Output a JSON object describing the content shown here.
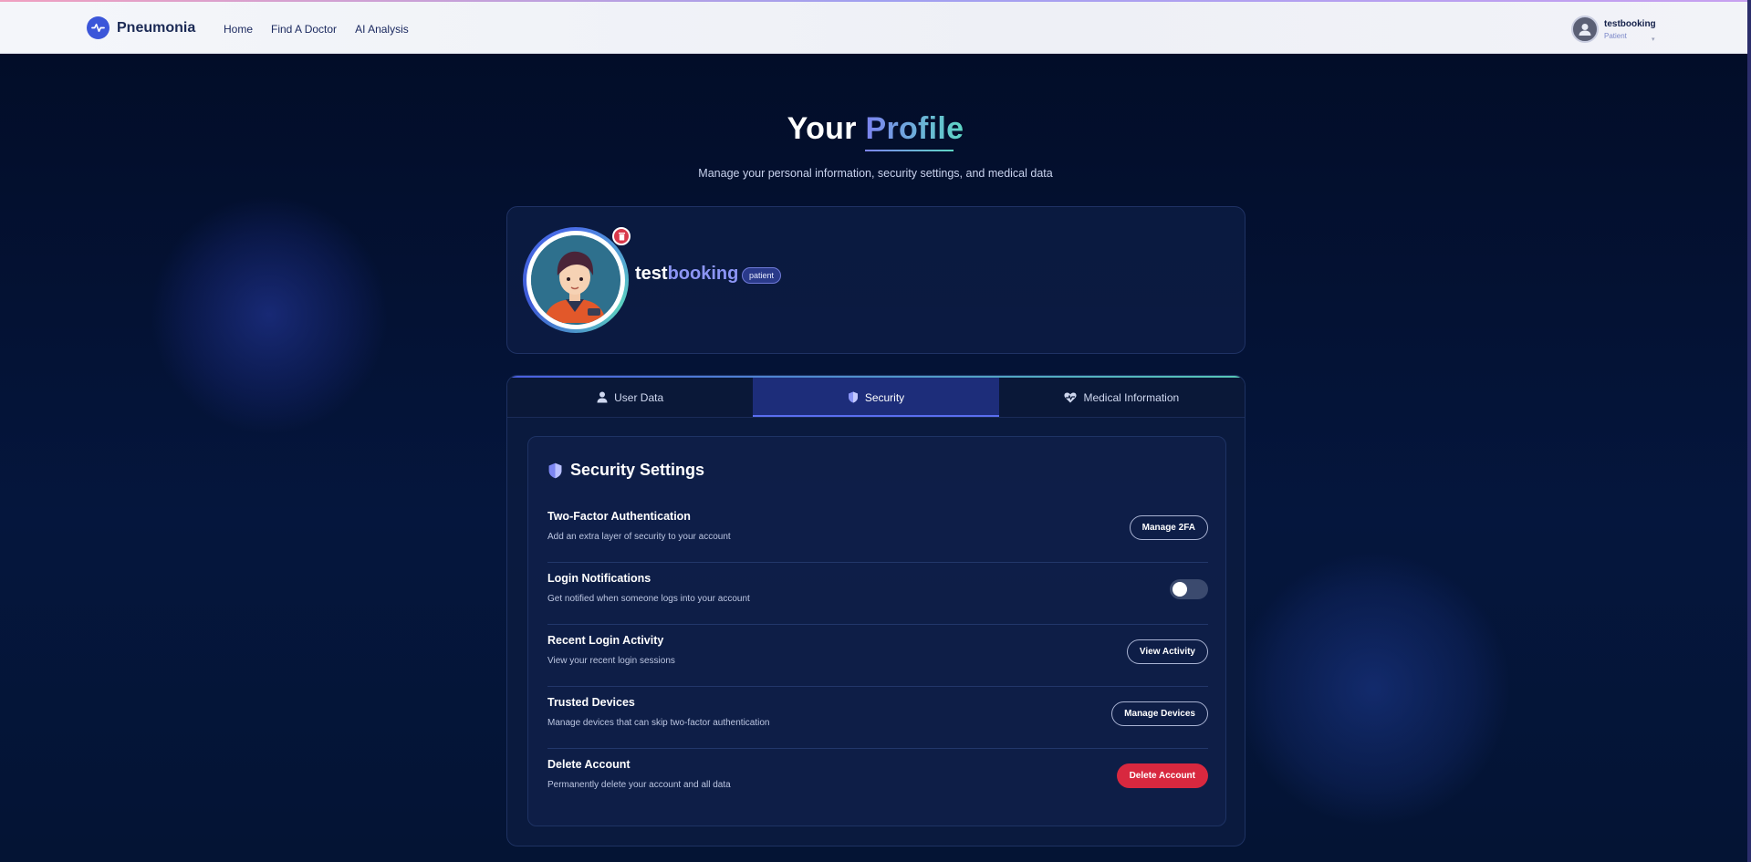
{
  "app": {
    "name": "Pneumonia"
  },
  "nav": {
    "links": [
      "Home",
      "Find A Doctor",
      "AI Analysis"
    ]
  },
  "user": {
    "name": "testbooking",
    "role": "Patient",
    "caret": "▾"
  },
  "page": {
    "title_main": "Your",
    "title_accent": "Profile",
    "subtitle": "Manage your personal information, security settings, and medical data"
  },
  "profile": {
    "name_part1": "test",
    "name_part2": "booking",
    "role_badge": "patient"
  },
  "tabs": [
    {
      "label": "User Data",
      "icon": "user-icon",
      "active": false
    },
    {
      "label": "Security",
      "icon": "shield-icon",
      "active": true
    },
    {
      "label": "Medical Information",
      "icon": "heart-pulse-icon",
      "active": false
    }
  ],
  "security": {
    "title": "Security Settings",
    "rows": [
      {
        "title": "Two-Factor Authentication",
        "desc": "Add an extra layer of security to your account",
        "action": "Manage 2FA"
      },
      {
        "title": "Login Notifications",
        "desc": "Get notified when someone logs into your account",
        "toggle_on": false
      },
      {
        "title": "Recent Login Activity",
        "desc": "View your recent login sessions",
        "action": "View Activity"
      },
      {
        "title": "Trusted Devices",
        "desc": "Manage devices that can skip two-factor authentication",
        "action": "Manage Devices"
      },
      {
        "title": "Delete Account",
        "desc": "Permanently delete your account and all data",
        "action": "Delete Account"
      }
    ]
  },
  "colors": {
    "accent": "#5a6ef0",
    "accent_teal": "#5ed6c4",
    "danger": "#d8283f",
    "background": "#03112f"
  }
}
